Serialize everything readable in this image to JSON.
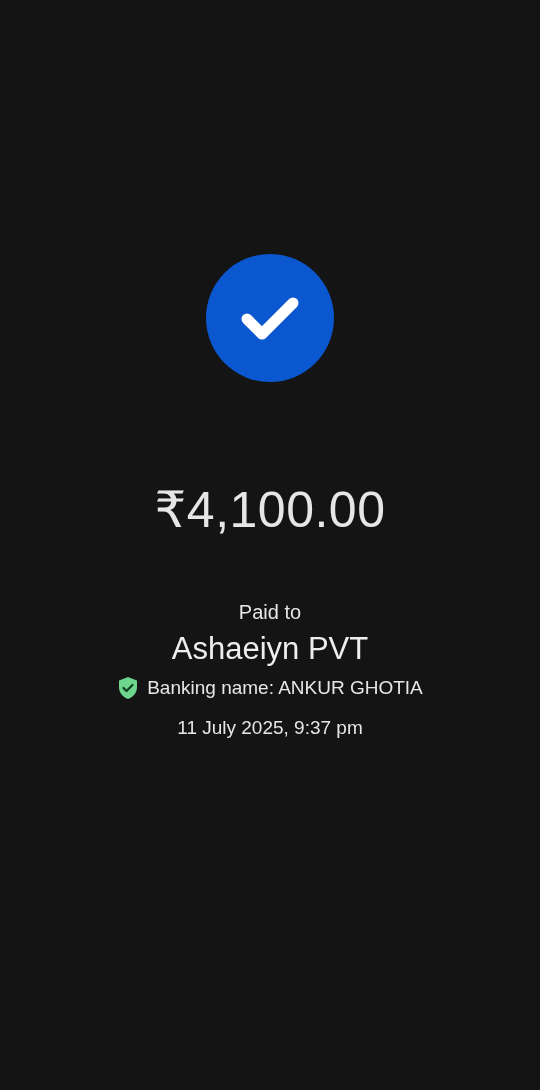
{
  "payment": {
    "success": true,
    "amount": "₹4,100.00",
    "paid_to_label": "Paid to",
    "payee": "Ashaeiyn PVT",
    "banking_name": "Banking name: ANKUR GHOTIA",
    "verified": true,
    "timestamp": "11 July 2025, 9:37 pm"
  }
}
